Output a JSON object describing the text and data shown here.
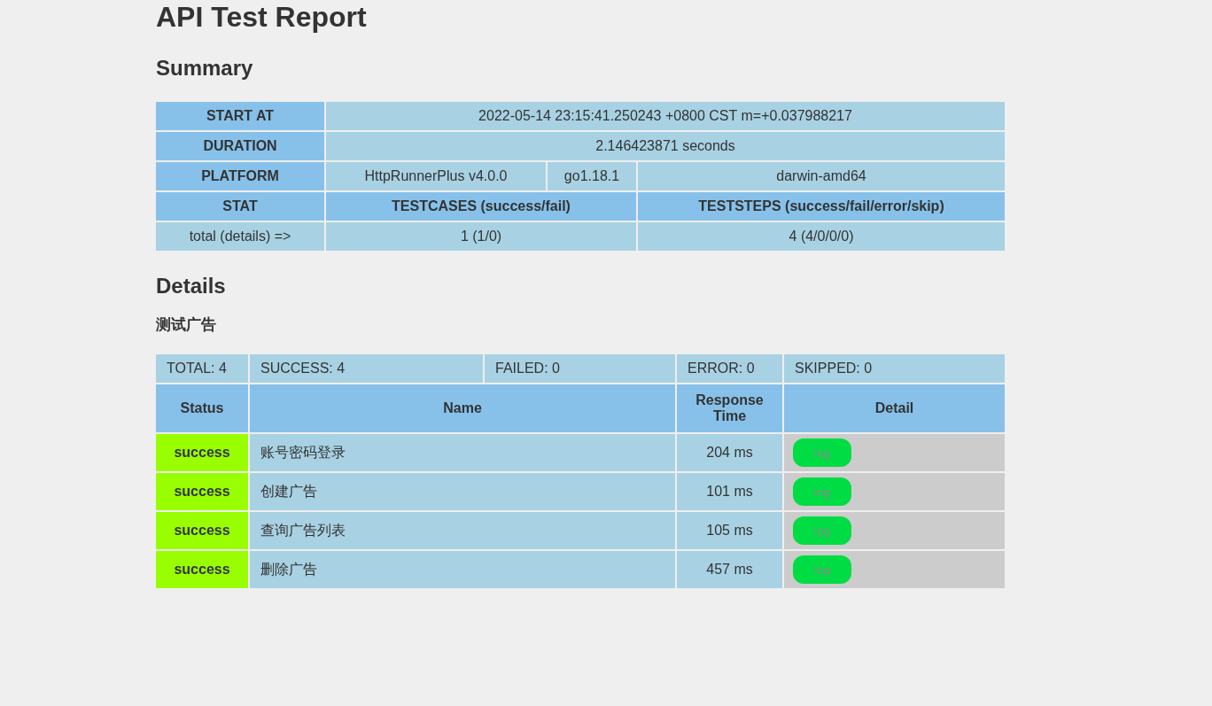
{
  "title": "API Test Report",
  "summary": {
    "heading": "Summary",
    "start_at": {
      "label": "START AT",
      "value": "2022-05-14 23:15:41.250243 +0800 CST m=+0.037988217"
    },
    "duration": {
      "label": "DURATION",
      "value": "2.146423871 seconds"
    },
    "platform": {
      "label": "PLATFORM",
      "values": [
        "HttpRunnerPlus v4.0.0",
        "go1.18.1",
        "darwin-amd64"
      ]
    },
    "stat": {
      "label": "STAT",
      "testcases_header": "TESTCASES (success/fail)",
      "teststeps_header": "TESTSTEPS (success/fail/error/skip)",
      "row_label": "total (details) =>",
      "testcases": "1 (1/0)",
      "teststeps": "4 (4/0/0/0)"
    }
  },
  "details": {
    "heading": "Details",
    "testcase": {
      "name": "测试广告",
      "counts": [
        "TOTAL: 4",
        "SUCCESS: 4",
        "FAILED: 0",
        "ERROR: 0",
        "SKIPPED: 0"
      ],
      "columns": [
        "Status",
        "Name",
        "Response Time",
        "Detail"
      ],
      "steps": [
        {
          "status": "success",
          "kind": "success",
          "name": "账号密码登录",
          "response_time": "204 ms",
          "detail": "log"
        },
        {
          "status": "success",
          "kind": "success",
          "name": "创建广告",
          "response_time": "101 ms",
          "detail": "log"
        },
        {
          "status": "success",
          "kind": "success",
          "name": "查询广告列表",
          "response_time": "105 ms",
          "detail": "log"
        },
        {
          "status": "success",
          "kind": "success",
          "name": "删除广告",
          "response_time": "457 ms",
          "detail": "log"
        }
      ]
    }
  }
}
